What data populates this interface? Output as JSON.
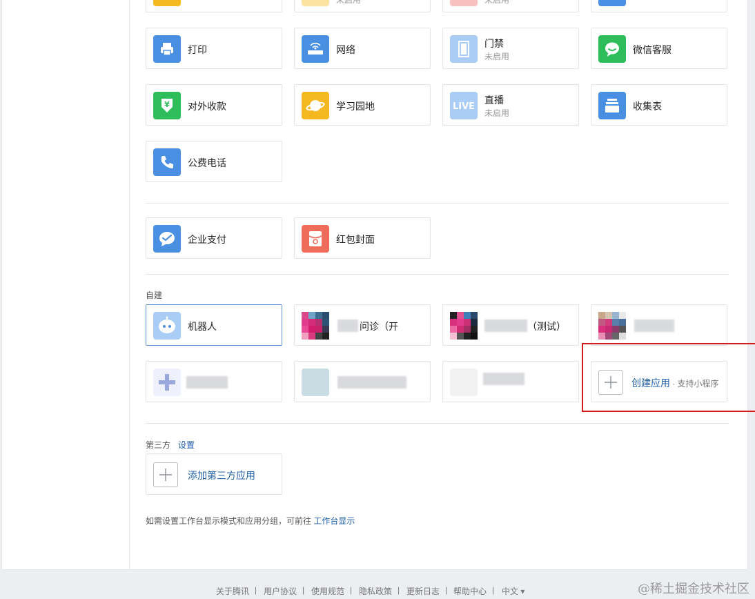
{
  "top_row": {
    "sub_1": "未启用",
    "sub_2": "未启用"
  },
  "apps": [
    {
      "name": "打印",
      "status": "",
      "icon": "printer-icon"
    },
    {
      "name": "网络",
      "status": "",
      "icon": "router-icon"
    },
    {
      "name": "门禁",
      "status": "未启用",
      "icon": "door-icon"
    },
    {
      "name": "微信客服",
      "status": "",
      "icon": "chat-bubble-icon"
    },
    {
      "name": "对外收款",
      "status": "",
      "icon": "yuan-shield-icon"
    },
    {
      "name": "学习园地",
      "status": "",
      "icon": "planet-icon"
    },
    {
      "name": "直播",
      "status": "未启用",
      "icon": "live-icon"
    },
    {
      "name": "收集表",
      "status": "",
      "icon": "tray-icon"
    },
    {
      "name": "公费电话",
      "status": "",
      "icon": "phone-icon"
    }
  ],
  "payment_apps": [
    {
      "name": "企业支付",
      "icon": "wechat-pay-icon"
    },
    {
      "name": "红包封面",
      "icon": "red-packet-icon"
    }
  ],
  "self_built": {
    "label": "自建",
    "items": [
      {
        "name": "机器人",
        "icon": "robot-icon"
      },
      {
        "name": "问诊（开",
        "icon": "mosaic-icon"
      },
      {
        "name": "（测试）",
        "icon": "mosaic-icon"
      }
    ],
    "create_label": "创建应用",
    "create_hint": "· 支持小程序"
  },
  "third_party": {
    "label": "第三方",
    "settings_link": "设置",
    "add_label": "添加第三方应用"
  },
  "note": {
    "text": "如需设置工作台显示模式和应用分组，可前往",
    "link": "工作台显示"
  },
  "footer": {
    "links": [
      "关于腾讯",
      "用户协议",
      "使用规范",
      "隐私政策",
      "更新日志",
      "帮助中心"
    ],
    "separator": "|",
    "language": "中文 ▾"
  },
  "watermark": "@稀土掘金技术社区",
  "colors": {
    "blue": "#4a90e2",
    "green": "#2dbd5a",
    "yellow": "#f5b820",
    "light_blue": "#a9cdf5",
    "red_coral": "#ef6b5a",
    "link": "#1f5fa8",
    "highlight_red": "#d7191c"
  }
}
